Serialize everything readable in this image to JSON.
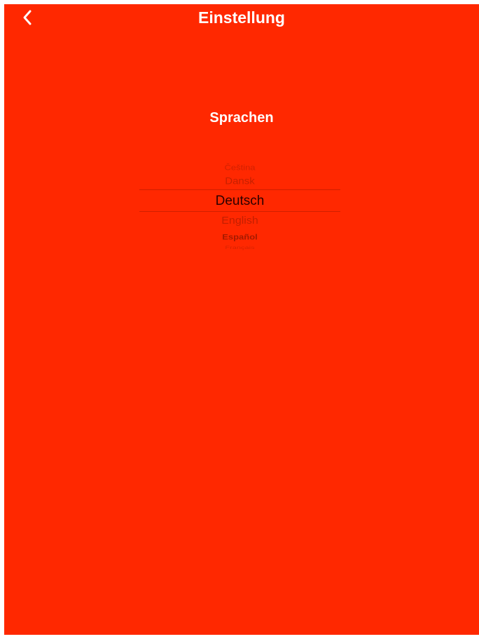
{
  "app": {
    "background_color": "#ff2800"
  },
  "nav": {
    "title": "Einstellung",
    "back_icon": "chevron-left-icon"
  },
  "section": {
    "title": "Sprachen"
  },
  "language_picker": {
    "selected": "Deutsch",
    "options": [
      "Čeština",
      "Dansk",
      "Deutsch",
      "English",
      "Español",
      "Français"
    ]
  }
}
